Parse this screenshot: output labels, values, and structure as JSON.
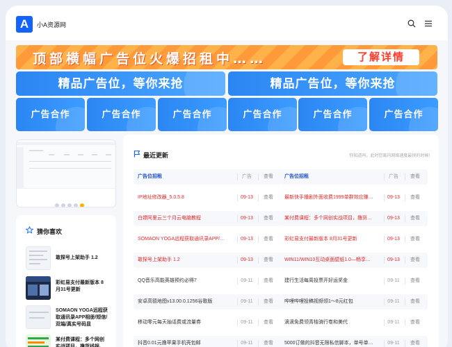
{
  "header": {
    "logo": "A",
    "site_name": "小A资源网"
  },
  "banner": {
    "text": "顶部横幅广告位火爆招租中……",
    "button": "了解详情"
  },
  "ads_big": [
    "精品广告位，等你来抢",
    "精品广告位，等你来抢"
  ],
  "ads_small": [
    "广告合作",
    "广告合作",
    "广告合作",
    "广告合作",
    "广告合作",
    "广告合作"
  ],
  "guess": {
    "title": "猜你喜欢",
    "items": [
      {
        "title": "敢探号上架助手 1.2"
      },
      {
        "title": "彩虹易支付最新版本 8月31号更新"
      },
      {
        "title": "SOMAON YOGA远程获取通讯录APP相册/短信/双端/真实号码显"
      },
      {
        "title": "某付费课程：多个网创实战项目，撸货线报、追号… 创业有道赚钱"
      }
    ]
  },
  "recent": {
    "title": "最近更新",
    "subtitle": "你知道吗，此时您离内网络速度最快的时候!",
    "columns": [
      {
        "header": {
          "title": "广告位招租",
          "date": "广告",
          "view": "查看"
        },
        "rows": [
          {
            "title": "IP地址修改器_5.0.5.8",
            "date": "09-13",
            "view": "查看",
            "red": true
          },
          {
            "title": "白嫖阿里云三个月云电脑教程",
            "date": "09-13",
            "view": "查看",
            "red": true
          },
          {
            "title": "SOMAON YOGA远程获取通讯录APP/…",
            "date": "09-13",
            "view": "查看",
            "red": true
          },
          {
            "title": "敢探号上架助手 1.2",
            "date": "09-13",
            "view": "查看",
            "red": true
          },
          {
            "title": "QQ音乐高能英雄预约必得7",
            "date": "09-11",
            "view": "查看",
            "red": false
          },
          {
            "title": "安卓高德地图v13.00.0.1256谷歌版",
            "date": "09-11",
            "view": "查看",
            "red": false
          },
          {
            "title": "移动零元每天抽话费或流量券",
            "date": "09-11",
            "view": "查看",
            "red": false
          },
          {
            "title": "抖音0.01元撸苹果手机壳包邮",
            "date": "09-11",
            "view": "查看",
            "red": false
          }
        ]
      },
      {
        "header": {
          "title": "广告位招租",
          "date": "广告",
          "view": "查看"
        },
        "rows": [
          {
            "title": "最新快手播剧外面收费1999单群效应赚…",
            "date": "09-13",
            "view": "查看",
            "red": true
          },
          {
            "title": "某付费课程：多个网创实战项目，撸货…",
            "date": "09-13",
            "view": "查看",
            "red": true
          },
          {
            "title": "彩虹易支付最新版本 8月31号更新",
            "date": "09-13",
            "view": "查看",
            "red": true
          },
          {
            "title": "WIN11/WIN10互动桌面壁纸1.0—畅享…",
            "date": "09-13",
            "view": "查看",
            "red": true
          },
          {
            "title": "建行生活每周投票开好运奖金",
            "date": "09-11",
            "view": "查看",
            "red": false
          },
          {
            "title": "哔哩哔哩投稿视频领1～8元红包",
            "date": "09-11",
            "view": "查看",
            "red": false
          },
          {
            "title": "滴滴免费领青桔骑行卷和美代",
            "date": "09-11",
            "view": "查看",
            "red": false
          },
          {
            "title": "5000订做的抖音无限私信脚本，单号单…",
            "date": "09-11",
            "view": "查看",
            "red": false
          }
        ]
      }
    ]
  },
  "colors": {
    "accent": "#1463ff",
    "red": "#e02828",
    "banner": "#ff9a3a",
    "ad_blue": "#2b86f3"
  }
}
